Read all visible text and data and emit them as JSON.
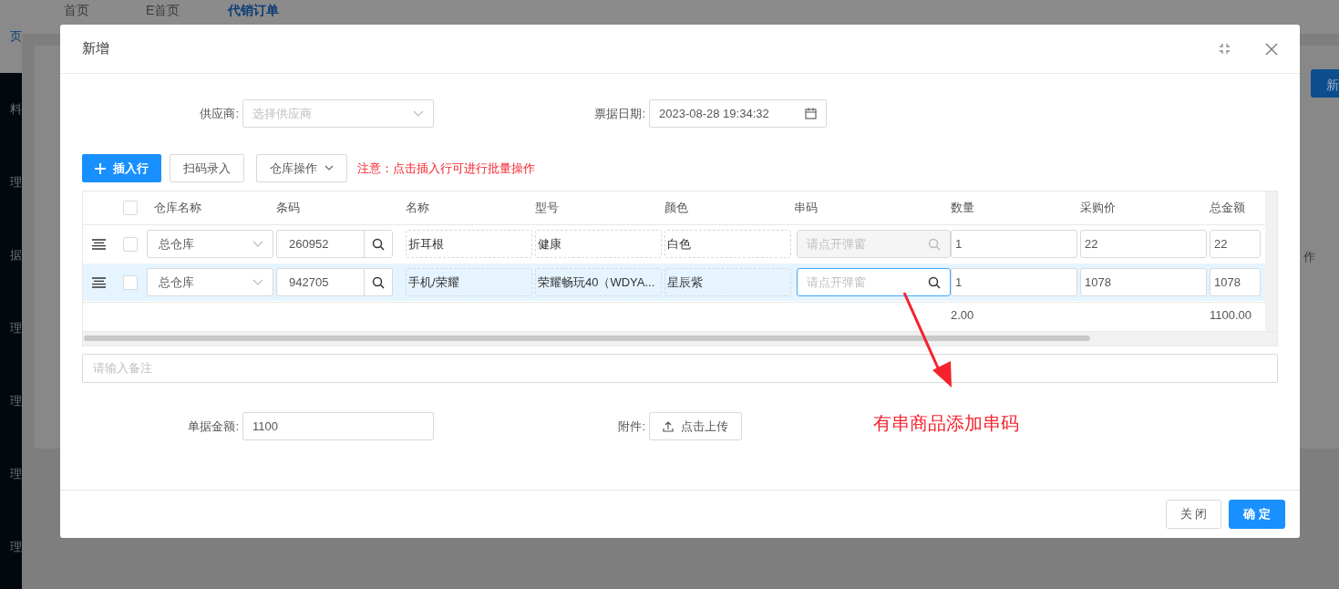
{
  "background": {
    "nav_tabs": [
      {
        "label": "首页",
        "selected": false
      },
      {
        "label": "E首页",
        "selected": false
      },
      {
        "label": "代销订单",
        "selected": true
      }
    ],
    "sidebar_items": [
      {
        "label": "页",
        "selected": true
      },
      {
        "label": "料",
        "selected": false
      },
      {
        "label": "理",
        "selected": false
      },
      {
        "label": "据",
        "selected": false
      },
      {
        "label": "理",
        "selected": false
      },
      {
        "label": "理",
        "selected": false
      },
      {
        "label": "理",
        "selected": false
      },
      {
        "label": "理",
        "selected": false
      }
    ],
    "new_button": "新",
    "column_fragment": "作"
  },
  "dialog": {
    "title": "新增",
    "supplier": {
      "label": "供应商:",
      "placeholder": "选择供应商"
    },
    "date": {
      "label": "票据日期:",
      "value": "2023-08-28 19:34:32"
    },
    "toolbar": {
      "insert_row": "插入行",
      "scan": "扫码录入",
      "warehouse_ops": "仓库操作",
      "notice": "注意：点击插入行可进行批量操作"
    },
    "table": {
      "header_checked": false,
      "columns": [
        "仓库名称",
        "条码",
        "名称",
        "型号",
        "颜色",
        "串码",
        "数量",
        "采购价",
        "总金额"
      ],
      "rows": [
        {
          "selected": false,
          "checked": false,
          "warehouse": "总仓库",
          "barcode": "260952",
          "name": "折耳根",
          "model": "健康",
          "color_name": "白色",
          "serial": {
            "placeholder": "请点开弹窗",
            "disabled": true,
            "focused": false
          },
          "qty": "1",
          "price": "22",
          "total": "22"
        },
        {
          "selected": true,
          "checked": false,
          "warehouse": "总仓库",
          "barcode": "942705",
          "name": "手机/荣耀",
          "model": "荣耀畅玩40（WDYA...",
          "color_name": "星辰紫",
          "serial": {
            "placeholder": "请点开弹窗",
            "disabled": false,
            "focused": true
          },
          "qty": "1",
          "price": "1078",
          "total": "1078"
        }
      ],
      "totals": {
        "qty": "2.00",
        "total": "1100.00"
      }
    },
    "remark": {
      "placeholder": "请输入备注"
    },
    "amount": {
      "label": "单据金额:",
      "value": "1100"
    },
    "attachment": {
      "label": "附件:",
      "button": "点击上传"
    },
    "buttons": [
      {
        "label": "关 闭",
        "kind": "secondary"
      },
      {
        "label": "确 定",
        "kind": "primary"
      }
    ]
  },
  "annotation": "有串商品添加串码"
}
